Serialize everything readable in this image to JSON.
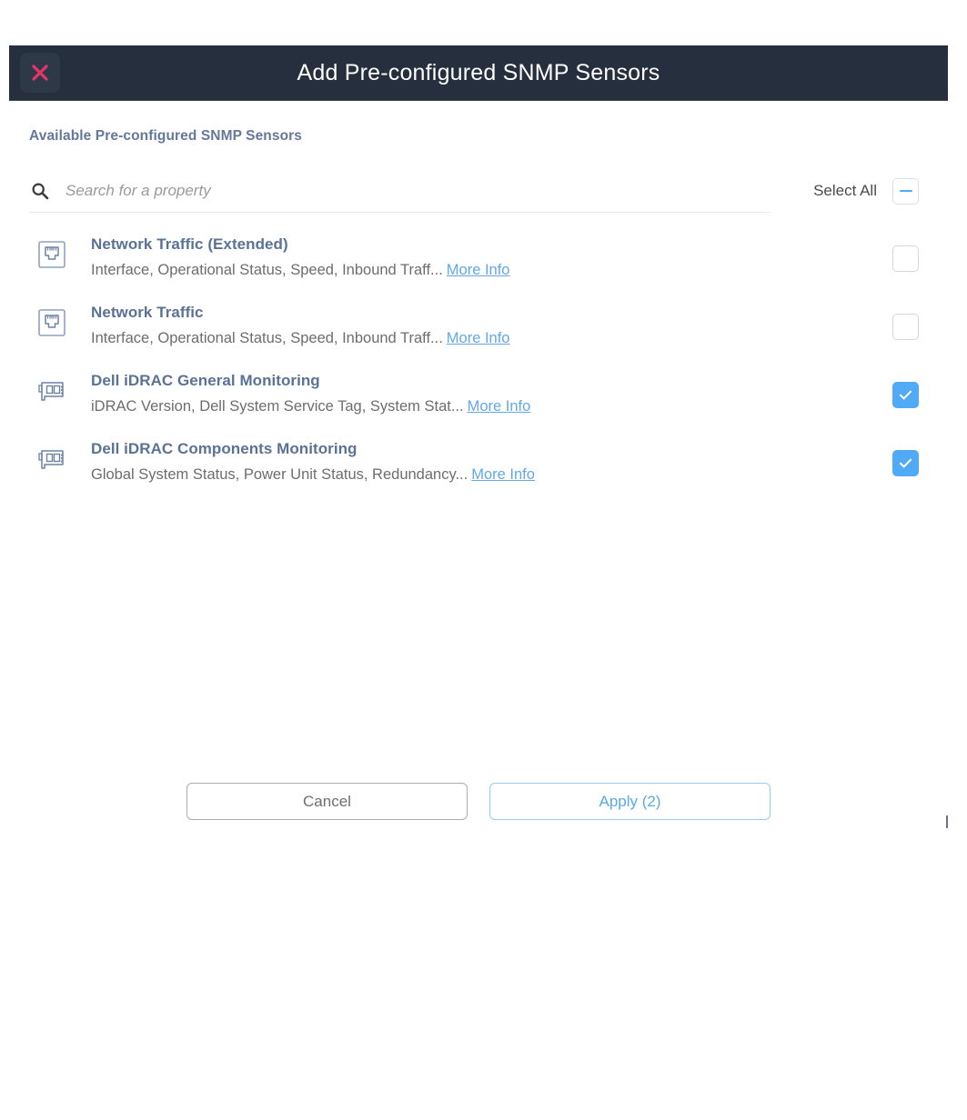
{
  "dialog": {
    "title": "Add Pre-configured SNMP Sensors",
    "close_icon": "close-x-icon",
    "accent_color": "#e8336d",
    "titlebar_color": "#252f3d"
  },
  "section": {
    "heading": "Available Pre-configured SNMP Sensors",
    "heading_color": "#64789a"
  },
  "search": {
    "icon": "search-icon",
    "placeholder": "Search for a property",
    "value": ""
  },
  "select_all": {
    "label": "Select All",
    "state": "indeterminate"
  },
  "sensors": [
    {
      "icon": "ethernet-port-icon",
      "title": "Network Traffic (Extended)",
      "description": "Interface, Operational Status, Speed, Inbound Traff...",
      "more_info": "More Info",
      "checked": false
    },
    {
      "icon": "ethernet-port-icon",
      "title": "Network Traffic",
      "description": "Interface, Operational Status, Speed, Inbound Traff...",
      "more_info": "More Info",
      "checked": false
    },
    {
      "icon": "expansion-card-icon",
      "title": "Dell iDRAC General Monitoring",
      "description": "iDRAC Version, Dell System Service Tag, System Stat...",
      "more_info": "More Info",
      "checked": true
    },
    {
      "icon": "expansion-card-icon",
      "title": "Dell iDRAC Components Monitoring",
      "description": "Global System Status, Power Unit Status, Redundancy...",
      "more_info": "More Info",
      "checked": true
    }
  ],
  "footer": {
    "cancel_label": "Cancel",
    "apply_label": "Apply (2)",
    "selected_count": 2,
    "apply_color": "#5aa9e6"
  }
}
